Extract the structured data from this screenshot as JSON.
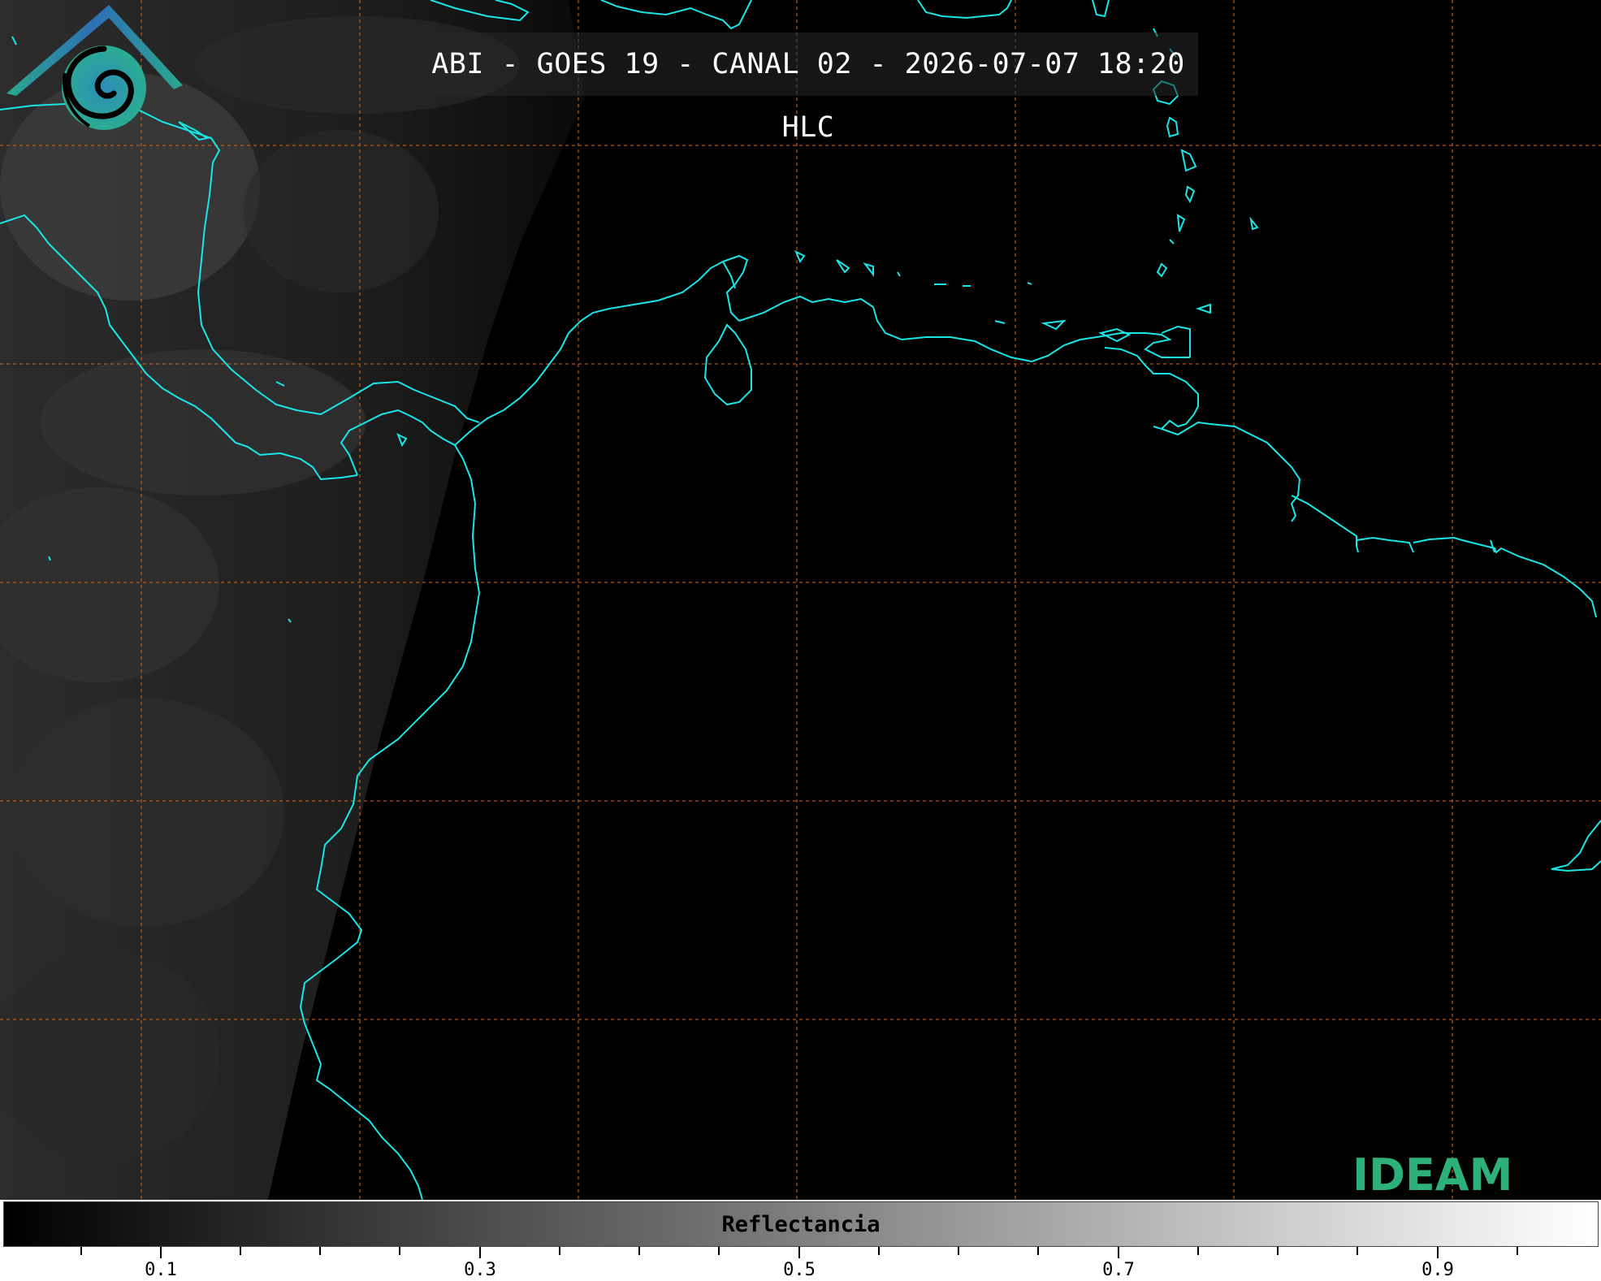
{
  "title": "ABI - GOES 19 - CANAL 02 - 2026-07-07 18:20 HLC",
  "colorbar": {
    "label": "Reflectancia",
    "range": [
      0.0,
      1.0
    ],
    "ticks": [
      "0.1",
      "0.3",
      "0.5",
      "0.7",
      "0.9"
    ]
  },
  "logo": {
    "text": "IDEAM"
  },
  "colors": {
    "coastline": "#19e6e6",
    "gridlines": "#c8641e",
    "background": "#000000"
  }
}
